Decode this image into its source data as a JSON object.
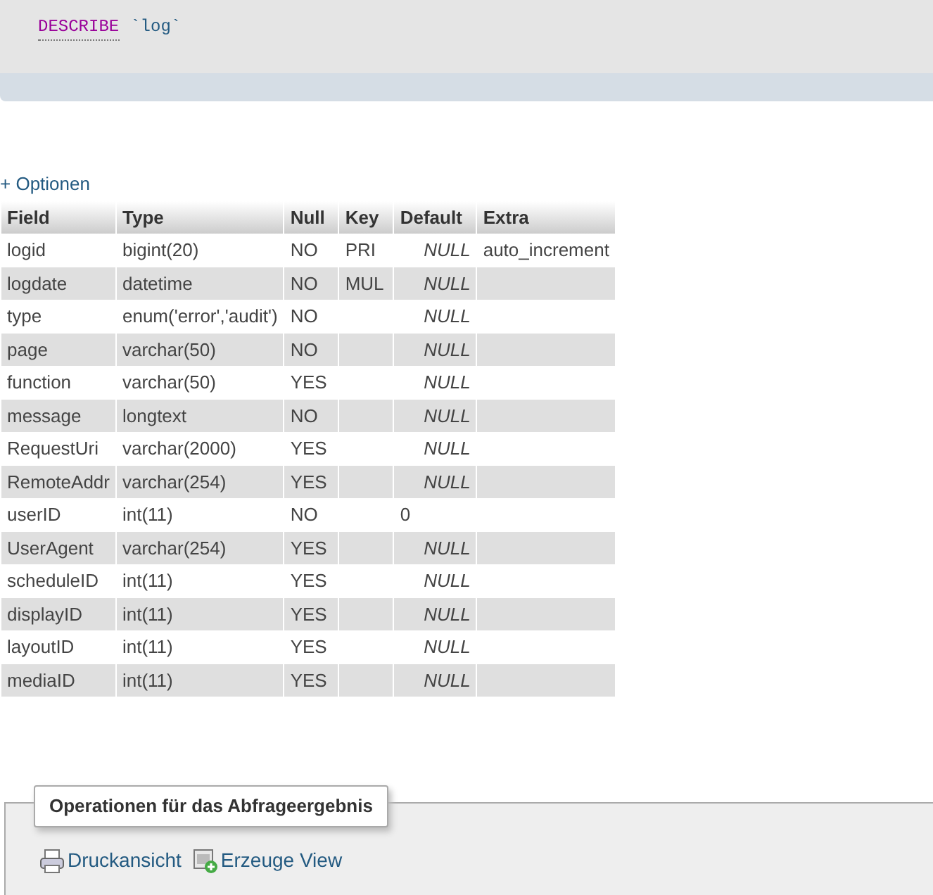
{
  "query": {
    "keyword": "DESCRIBE",
    "identifier": "`log`"
  },
  "options_link": "+ Optionen",
  "table": {
    "columns": [
      "Field",
      "Type",
      "Null",
      "Key",
      "Default",
      "Extra"
    ],
    "rows": [
      {
        "field": "logid",
        "type": "bigint(20)",
        "null": "NO",
        "key": "PRI",
        "default": {
          "kind": "null",
          "text": "NULL"
        },
        "extra": "auto_increment"
      },
      {
        "field": "logdate",
        "type": "datetime",
        "null": "NO",
        "key": "MUL",
        "default": {
          "kind": "null",
          "text": "NULL"
        }
      },
      {
        "field": "type",
        "type": "enum('error','audit')",
        "null": "NO",
        "default": {
          "kind": "null",
          "text": "NULL"
        }
      },
      {
        "field": "page",
        "type": "varchar(50)",
        "null": "NO",
        "default": {
          "kind": "null",
          "text": "NULL"
        }
      },
      {
        "field": "function",
        "type": "varchar(50)",
        "null": "YES",
        "default": {
          "kind": "null",
          "text": "NULL"
        }
      },
      {
        "field": "message",
        "type": "longtext",
        "null": "NO",
        "default": {
          "kind": "null",
          "text": "NULL"
        }
      },
      {
        "field": "RequestUri",
        "type": "varchar(2000)",
        "null": "YES",
        "default": {
          "kind": "null",
          "text": "NULL"
        }
      },
      {
        "field": "RemoteAddr",
        "type": "varchar(254)",
        "null": "YES",
        "default": {
          "kind": "null",
          "text": "NULL"
        }
      },
      {
        "field": "userID",
        "type": "int(11)",
        "null": "NO",
        "default": {
          "kind": "value",
          "text": "0"
        }
      },
      {
        "field": "UserAgent",
        "type": "varchar(254)",
        "null": "YES",
        "default": {
          "kind": "null",
          "text": "NULL"
        }
      },
      {
        "field": "scheduleID",
        "type": "int(11)",
        "null": "YES",
        "default": {
          "kind": "null",
          "text": "NULL"
        }
      },
      {
        "field": "displayID",
        "type": "int(11)",
        "null": "YES",
        "default": {
          "kind": "null",
          "text": "NULL"
        }
      },
      {
        "field": "layoutID",
        "type": "int(11)",
        "null": "YES",
        "default": {
          "kind": "null",
          "text": "NULL"
        }
      },
      {
        "field": "mediaID",
        "type": "int(11)",
        "null": "YES",
        "default": {
          "kind": "null",
          "text": "NULL"
        }
      }
    ]
  },
  "operations": {
    "title": "Operationen für das Abfrageergebnis",
    "links": [
      {
        "kind": "print",
        "label": "Druckansicht"
      },
      {
        "kind": "view",
        "label": "Erzeuge View"
      }
    ]
  }
}
